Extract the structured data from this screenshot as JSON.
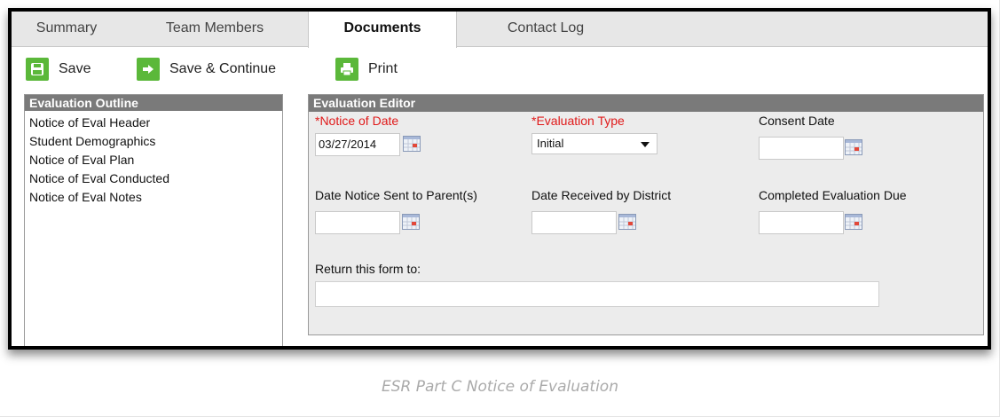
{
  "tabs": [
    {
      "label": "Summary"
    },
    {
      "label": "Team Members"
    },
    {
      "label": "Documents",
      "active": true
    },
    {
      "label": "Contact Log"
    }
  ],
  "toolbar": {
    "save_label": "Save",
    "save_continue_label": "Save & Continue",
    "print_label": "Print",
    "icon_color": "#5bb83a"
  },
  "outline": {
    "title": "Evaluation Outline",
    "items": [
      {
        "label": "Notice of Eval Header"
      },
      {
        "label": "Student Demographics"
      },
      {
        "label": "Notice of Eval Plan"
      },
      {
        "label": "Notice of Eval Conducted"
      },
      {
        "label": "Notice of Eval Notes"
      }
    ]
  },
  "editor": {
    "title": "Evaluation Editor",
    "fields": {
      "notice_date": {
        "label": "*Notice of Date",
        "value": "03/27/2014"
      },
      "evaluation_type": {
        "label": "*Evaluation Type",
        "value": "Initial"
      },
      "consent_date": {
        "label": "Consent Date",
        "value": ""
      },
      "date_notice_sent": {
        "label": "Date Notice Sent to Parent(s)",
        "value": ""
      },
      "date_received": {
        "label": "Date Received by District",
        "value": ""
      },
      "completed_eval_due": {
        "label": "Completed Evaluation Due",
        "value": ""
      },
      "return_form_to": {
        "label": "Return this form to:",
        "value": ""
      }
    },
    "required_color": "#e01a1a",
    "header_color": "#7a7a7a"
  },
  "caption": "ESR Part C Notice of Evaluation"
}
